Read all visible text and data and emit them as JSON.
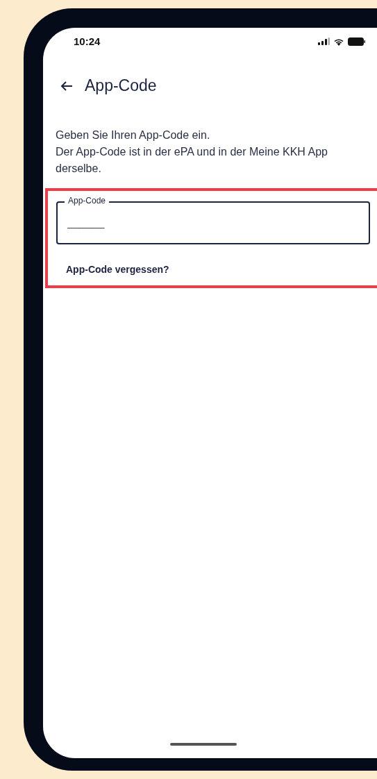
{
  "status_bar": {
    "time": "10:24"
  },
  "header": {
    "title": "App-Code"
  },
  "instructions": [
    "Geben Sie Ihren App-Code ein.",
    "Der App-Code ist in der ePA und in der Meine KKH App derselbe."
  ],
  "app_code_field": {
    "label": "App-Code",
    "placeholder": "______"
  },
  "forgot_link": "App-Code vergessen?"
}
